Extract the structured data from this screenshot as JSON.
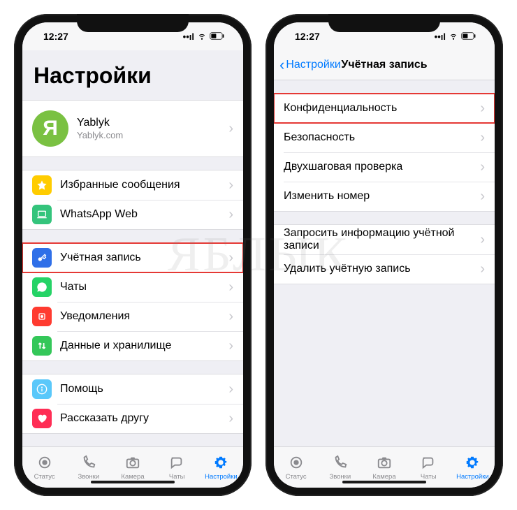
{
  "status": {
    "time": "12:27"
  },
  "watermark": "ЯБЛЫК",
  "left": {
    "title": "Настройки",
    "profile": {
      "initial": "Я",
      "name": "Yablyk",
      "sub": "Yablyk.com"
    },
    "g1": [
      {
        "label": "Избранные сообщения",
        "icon": "star",
        "color": "#ffcc00"
      },
      {
        "label": "WhatsApp Web",
        "icon": "laptop",
        "color": "#34c47c"
      }
    ],
    "g2": [
      {
        "label": "Учётная запись",
        "icon": "key",
        "color": "#2f6fe8",
        "hl": true
      },
      {
        "label": "Чаты",
        "icon": "whatsapp",
        "color": "#25d366"
      },
      {
        "label": "Уведомления",
        "icon": "bell",
        "color": "#ff3b30"
      },
      {
        "label": "Данные и хранилище",
        "icon": "updown",
        "color": "#34c759"
      }
    ],
    "g3": [
      {
        "label": "Помощь",
        "icon": "info",
        "color": "#5ac8fa"
      },
      {
        "label": "Рассказать другу",
        "icon": "heart",
        "color": "#ff2d55"
      }
    ]
  },
  "right": {
    "back": "Настройки",
    "title": "Учётная запись",
    "g1": [
      {
        "label": "Конфиденциальность",
        "hl": true
      },
      {
        "label": "Безопасность"
      },
      {
        "label": "Двухшаговая проверка"
      },
      {
        "label": "Изменить номер"
      }
    ],
    "g2": [
      {
        "label": "Запросить информацию учётной записи"
      },
      {
        "label": "Удалить учётную запись"
      }
    ]
  },
  "tabs": [
    {
      "label": "Статус",
      "icon": "status"
    },
    {
      "label": "Звонки",
      "icon": "phone"
    },
    {
      "label": "Камера",
      "icon": "camera"
    },
    {
      "label": "Чаты",
      "icon": "chats"
    },
    {
      "label": "Настройки",
      "icon": "gear",
      "active": true
    }
  ]
}
